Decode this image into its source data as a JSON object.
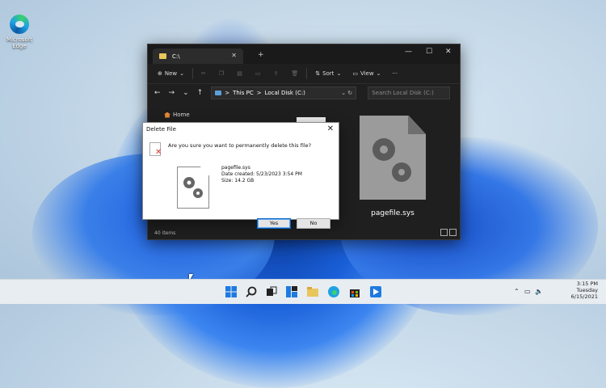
{
  "desktop": {
    "icons": [
      {
        "label": "Microsoft Edge",
        "icon": "edge-icon"
      }
    ]
  },
  "explorer": {
    "tab_title": "C:\\",
    "toolbar": {
      "new_label": "New",
      "sort_label": "Sort",
      "view_label": "View",
      "more_label": "···"
    },
    "address": {
      "crumb_1": "This PC",
      "crumb_2": "Local Disk (C:)",
      "separator": ">"
    },
    "search_placeholder": "Search Local Disk (C:)",
    "sidebar": {
      "home_label": "Home"
    },
    "status_items": "40 items",
    "file": {
      "name": "pagefile.sys",
      "icon": "system-file-icon"
    }
  },
  "dialog": {
    "title": "Delete File",
    "question": "Are you sure you want to permanently delete this file?",
    "file_name": "pagefile.sys",
    "date_created": "Date created: 5/23/2023 3:54 PM",
    "size": "Size: 14.2 GB",
    "yes_label": "Yes",
    "no_label": "No"
  },
  "taskbar": {
    "clock_time": "3:15 PM",
    "clock_day": "Tuesday",
    "clock_date": "6/15/2021"
  },
  "colors": {
    "explorer_bg": "#1f1f1f",
    "dialog_bg": "#ffffff",
    "accent": "#0066cc",
    "delete_x": "#d13c2c"
  }
}
